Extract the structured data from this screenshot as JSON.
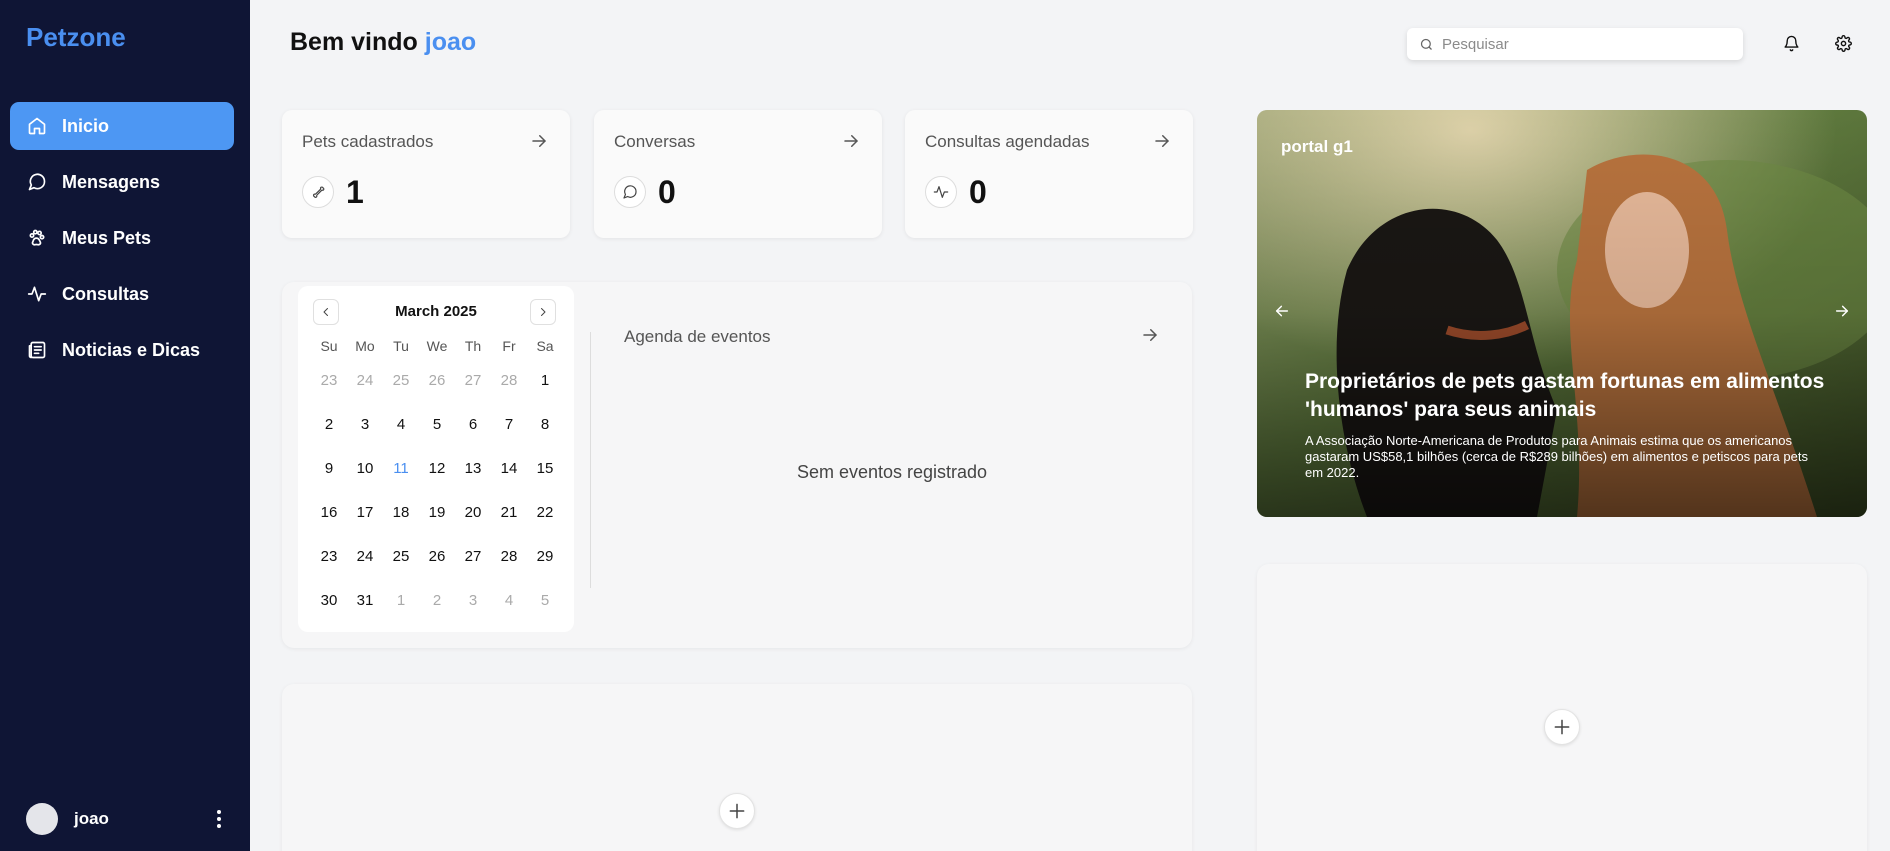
{
  "brand": "Petzone",
  "nav": [
    {
      "label": "Inicio",
      "icon": "home-icon",
      "active": true
    },
    {
      "label": "Mensagens",
      "icon": "message-icon",
      "active": false
    },
    {
      "label": "Meus Pets",
      "icon": "paw-icon",
      "active": false
    },
    {
      "label": "Consultas",
      "icon": "activity-icon",
      "active": false
    },
    {
      "label": "Noticias e Dicas",
      "icon": "newspaper-icon",
      "active": false
    }
  ],
  "user": {
    "name": "joao"
  },
  "header": {
    "welcome": "Bem vindo",
    "username": "joao",
    "search_placeholder": "Pesquisar"
  },
  "stats": [
    {
      "title": "Pets cadastrados",
      "value": "1",
      "icon": "bone-icon"
    },
    {
      "title": "Conversas",
      "value": "0",
      "icon": "chat-bubble-icon"
    },
    {
      "title": "Consultas agendadas",
      "value": "0",
      "icon": "activity-icon"
    }
  ],
  "calendar": {
    "month": "March 2025",
    "weekdays": [
      "Su",
      "Mo",
      "Tu",
      "We",
      "Th",
      "Fr",
      "Sa"
    ],
    "weeks": [
      [
        "23",
        "24",
        "25",
        "26",
        "27",
        "28",
        "1"
      ],
      [
        "2",
        "3",
        "4",
        "5",
        "6",
        "7",
        "8"
      ],
      [
        "9",
        "10",
        "11",
        "12",
        "13",
        "14",
        "15"
      ],
      [
        "16",
        "17",
        "18",
        "19",
        "20",
        "21",
        "22"
      ],
      [
        "23",
        "24",
        "25",
        "26",
        "27",
        "28",
        "29"
      ],
      [
        "30",
        "31",
        "1",
        "2",
        "3",
        "4",
        "5"
      ]
    ],
    "today": "11"
  },
  "events": {
    "title": "Agenda de eventos",
    "empty": "Sem eventos registrado"
  },
  "news": {
    "source": "portal g1",
    "headline": "Proprietários de pets gastam fortunas em alimentos 'humanos' para seus animais",
    "summary": "A Associação Norte-Americana de Produtos para Animais estima que os americanos gastaram US$58,1 bilhões (cerca de R$289 bilhões) em alimentos e petiscos para pets em 2022."
  },
  "colors": {
    "sidebar_bg": "#0f1535",
    "accent": "#4a8ff0",
    "active_nav": "#4d97f3",
    "page_bg": "#f3f4f6"
  }
}
